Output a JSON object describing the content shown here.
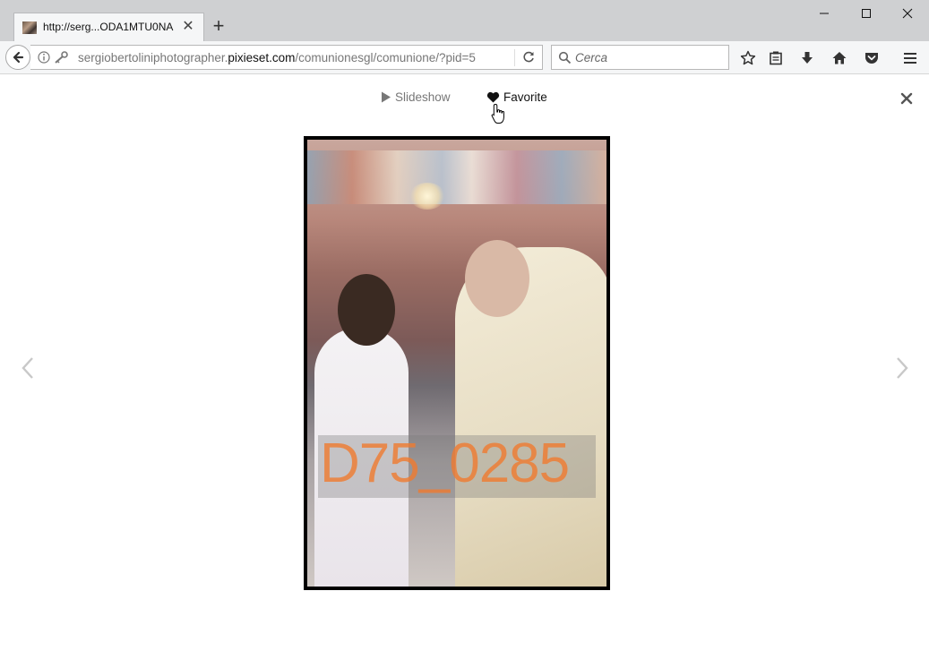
{
  "browser": {
    "tab": {
      "title": "http://serg...ODA1MTU0NA"
    },
    "urlbar": {
      "prefix": "sergiobertoliniphotographer.",
      "domain": "pixieset.com",
      "suffix": "/comunionesgl/comunione/?pid=5"
    },
    "search": {
      "placeholder": "Cerca"
    },
    "icons": {
      "back": "back-arrow-icon",
      "info": "info-icon",
      "key": "key-icon",
      "reload": "reload-icon",
      "search": "magnifier-icon",
      "bookmark": "star-icon",
      "reading": "clipboard-icon",
      "download": "download-arrow-icon",
      "home": "home-icon",
      "pocket": "pocket-icon",
      "menu": "hamburger-icon"
    }
  },
  "viewer": {
    "slideshow_label": "Slideshow",
    "favorite_label": "Favorite",
    "photo_watermark": "D75_0285",
    "colors": {
      "watermark": "#f07b30",
      "muted": "#777777"
    }
  }
}
